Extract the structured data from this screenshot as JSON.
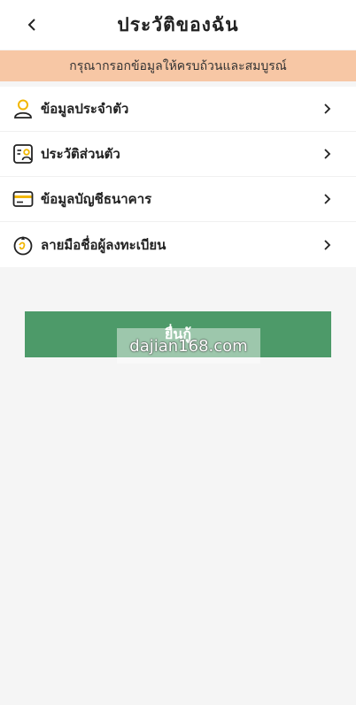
{
  "header": {
    "title": "ประวัติของฉัน"
  },
  "notice": {
    "text": "กรุณากรอกข้อมูลให้ครบถ้วนและสมบูรณ์"
  },
  "menu": {
    "items": [
      {
        "label": "ข้อมูลประจำตัว",
        "icon": "user-icon"
      },
      {
        "label": "ประวัติส่วนตัว",
        "icon": "id-card-icon"
      },
      {
        "label": "ข้อมูลบัญชีธนาคาร",
        "icon": "bank-card-icon"
      },
      {
        "label": "ลายมือชื่อผู้ลงทะเบียน",
        "icon": "signature-icon"
      }
    ]
  },
  "submit": {
    "label": "ยื่นกู้"
  },
  "watermark": {
    "text": "dajian168.com"
  },
  "colors": {
    "accent": "#4d9a69",
    "notice_bg": "#f7c7a5",
    "icon_yellow": "#f2b600"
  }
}
